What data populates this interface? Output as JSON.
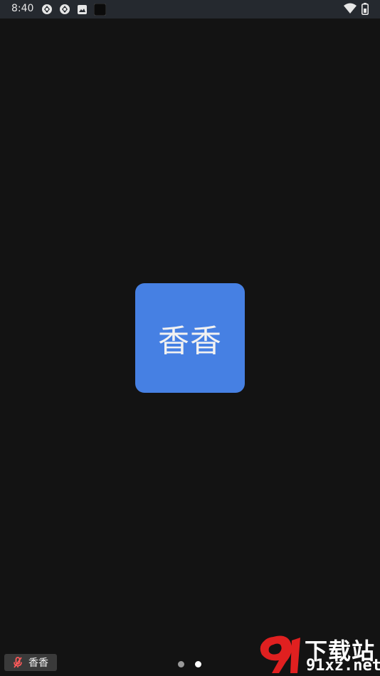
{
  "status_bar": {
    "time": "8:40",
    "left_icons": [
      "sync-icon",
      "sync-icon",
      "image-icon",
      "app-icon"
    ],
    "right_icons": [
      "wifi-icon",
      "battery-icon"
    ]
  },
  "participant": {
    "display_name": "香香",
    "tile_color": "#4680e3"
  },
  "name_chip": {
    "label": "香香",
    "mic_state": "muted",
    "mic_icon": "mic-off-icon",
    "mic_color": "#ff5a5a"
  },
  "pager": {
    "pages": 2,
    "active_page": 2,
    "inactive_color": "#9a9a9a",
    "active_color": "#ffffff"
  },
  "watermark": {
    "line1": "下载站",
    "line2": "91xz.net",
    "logo_color": "#e02020"
  }
}
